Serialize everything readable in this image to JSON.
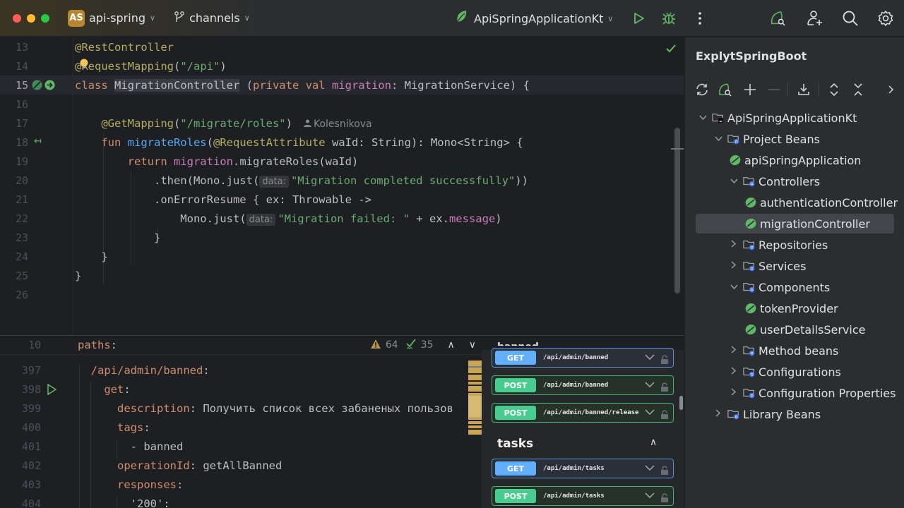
{
  "titlebar": {
    "project_initials": "AS",
    "project_name": "api-spring",
    "branch": "channels",
    "run_config": "ApiSpringApplicationKt",
    "icons": [
      "run-icon",
      "debug-icon",
      "more-icon",
      "spring-search-icon",
      "add-user-icon",
      "search-icon",
      "settings-icon"
    ]
  },
  "editor": {
    "lines": [
      {
        "n": "13",
        "parts": [
          [
            "ann",
            "@RestController"
          ]
        ]
      },
      {
        "n": "14",
        "parts": [
          [
            "ann",
            "@RequestMapping"
          ],
          [
            "plain",
            "("
          ],
          [
            "str",
            "\"/api\""
          ],
          [
            "plain",
            ")"
          ]
        ]
      },
      {
        "n": "15",
        "parts": [
          [
            "kw",
            "class "
          ],
          [
            "cls",
            "MigrationController"
          ],
          [
            "plain",
            " ("
          ],
          [
            "kw",
            "private val "
          ],
          [
            "prop",
            "migration"
          ],
          [
            "plain",
            ": MigrationService) {"
          ]
        ]
      },
      {
        "n": "16",
        "parts": []
      },
      {
        "n": "17",
        "parts": [
          [
            "plain",
            "    "
          ],
          [
            "ann",
            "@GetMapping"
          ],
          [
            "plain",
            "("
          ],
          [
            "str",
            "\"/migrate/roles\""
          ],
          [
            "plain",
            ")"
          ]
        ]
      },
      {
        "n": "18",
        "parts": [
          [
            "plain",
            "    "
          ],
          [
            "kw",
            "fun "
          ],
          [
            "fn",
            "migrateRoles"
          ],
          [
            "plain",
            "("
          ],
          [
            "ann",
            "@RequestAttribute"
          ],
          [
            "plain",
            " waId: String): Mono<String> {"
          ]
        ]
      },
      {
        "n": "19",
        "parts": [
          [
            "plain",
            "        "
          ],
          [
            "kw",
            "return "
          ],
          [
            "prop",
            "migration"
          ],
          [
            "plain",
            ".migrateRoles(waId)"
          ]
        ]
      },
      {
        "n": "20",
        "parts": [
          [
            "plain",
            "            .then(Mono.just("
          ],
          [
            "hint",
            "data:"
          ],
          [
            "str",
            "\"Migration completed successfully\""
          ],
          [
            "plain",
            "))"
          ]
        ]
      },
      {
        "n": "21",
        "parts": [
          [
            "plain",
            "            .onErrorResume { ex: Throwable ->"
          ]
        ]
      },
      {
        "n": "22",
        "parts": [
          [
            "plain",
            "                Mono.just("
          ],
          [
            "hint",
            "data:"
          ],
          [
            "str",
            "\"Migration failed: \""
          ],
          [
            "plain",
            " + ex."
          ],
          [
            "prop",
            "message"
          ],
          [
            "plain",
            ")"
          ]
        ]
      },
      {
        "n": "23",
        "parts": [
          [
            "plain",
            "            }"
          ]
        ]
      },
      {
        "n": "24",
        "parts": [
          [
            "plain",
            "    }"
          ]
        ]
      },
      {
        "n": "25",
        "parts": [
          [
            "plain",
            "}"
          ]
        ]
      },
      {
        "n": "26",
        "parts": []
      }
    ],
    "author": "Kolesnikova",
    "current_line": "15"
  },
  "yaml": {
    "sticky": {
      "n": "10",
      "key": "paths",
      "colon": ":"
    },
    "problems": {
      "warnings": "64",
      "ok": "35"
    },
    "lines": [
      {
        "n": "397",
        "indent": "  ",
        "key": "/api/admin/banned",
        "val": ""
      },
      {
        "n": "398",
        "indent": "    ",
        "key": "get",
        "val": ""
      },
      {
        "n": "399",
        "indent": "      ",
        "key": "description",
        "val": " Получить список всех забаненых пользов"
      },
      {
        "n": "400",
        "indent": "      ",
        "key": "tags",
        "val": ""
      },
      {
        "n": "401",
        "indent": "        ",
        "key": "",
        "val": "- banned"
      },
      {
        "n": "402",
        "indent": "      ",
        "key": "operationId",
        "val": " getAllBanned"
      },
      {
        "n": "403",
        "indent": "      ",
        "key": "responses",
        "val": ""
      },
      {
        "n": "404",
        "indent": "        ",
        "key": "",
        "val": "'200':"
      }
    ]
  },
  "swagger": {
    "cut_title": "banned",
    "ops_banned": [
      {
        "method": "GET",
        "path": "/api/admin/banned"
      },
      {
        "method": "POST",
        "path": "/api/admin/banned"
      },
      {
        "method": "POST",
        "path": "/api/admin/banned/release"
      }
    ],
    "tag": "tasks",
    "ops_tasks": [
      {
        "method": "GET",
        "path": "/api/admin/tasks"
      },
      {
        "method": "POST",
        "path": "/api/admin/tasks"
      }
    ]
  },
  "panel": {
    "title": "ExplytSpringBoot",
    "tree": [
      {
        "label": "ApiSpringApplicationKt",
        "level": 0,
        "chev": "open",
        "icon": "module"
      },
      {
        "label": "Project Beans",
        "level": 1,
        "chev": "open",
        "icon": "folder"
      },
      {
        "label": "apiSpringApplication",
        "level": 2,
        "chev": "none",
        "icon": "bean"
      },
      {
        "label": "Controllers",
        "level": 2,
        "chev": "open",
        "icon": "folder"
      },
      {
        "label": "authenticationController",
        "level": 3,
        "chev": "none",
        "icon": "bean"
      },
      {
        "label": "migrationController",
        "level": 3,
        "chev": "none",
        "icon": "bean",
        "selected": true
      },
      {
        "label": "Repositories",
        "level": 2,
        "chev": "closed",
        "icon": "folder"
      },
      {
        "label": "Services",
        "level": 2,
        "chev": "closed",
        "icon": "folder"
      },
      {
        "label": "Components",
        "level": 2,
        "chev": "open",
        "icon": "folder"
      },
      {
        "label": "tokenProvider",
        "level": 3,
        "chev": "none",
        "icon": "bean"
      },
      {
        "label": "userDetailsService",
        "level": 3,
        "chev": "none",
        "icon": "bean"
      },
      {
        "label": "Method beans",
        "level": 2,
        "chev": "closed",
        "icon": "folder"
      },
      {
        "label": "Configurations",
        "level": 2,
        "chev": "closed",
        "icon": "folder"
      },
      {
        "label": "Configuration Properties",
        "level": 2,
        "chev": "closed",
        "icon": "folder"
      },
      {
        "label": "Library Beans",
        "level": 1,
        "chev": "closed",
        "icon": "folder"
      }
    ]
  },
  "colors": {
    "accent_green": "#5fb865",
    "get_blue": "#61affe",
    "post_green": "#49cc90",
    "annotation": "#b3ae60",
    "keyword": "#cf8e6d",
    "string": "#6aab73"
  }
}
